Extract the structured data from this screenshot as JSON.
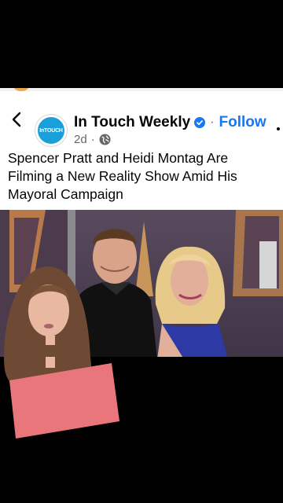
{
  "post": {
    "page_name": "In Touch Weekly",
    "avatar_text": "InTOUCH",
    "follow_label": "Follow",
    "time": "2d",
    "caption": "Spencer Pratt and Heidi Montag Are Filming a New Reality Show Amid His Mayoral Campaign"
  },
  "icons": {
    "back": "chevron-left-icon",
    "verified": "verified-badge-icon",
    "audience": "globe-icon",
    "more": "more-options-icon"
  },
  "colors": {
    "follow": "#1877f2",
    "verified": "#1877f2",
    "avatar": "#1a9fd8",
    "background": "#000000"
  }
}
